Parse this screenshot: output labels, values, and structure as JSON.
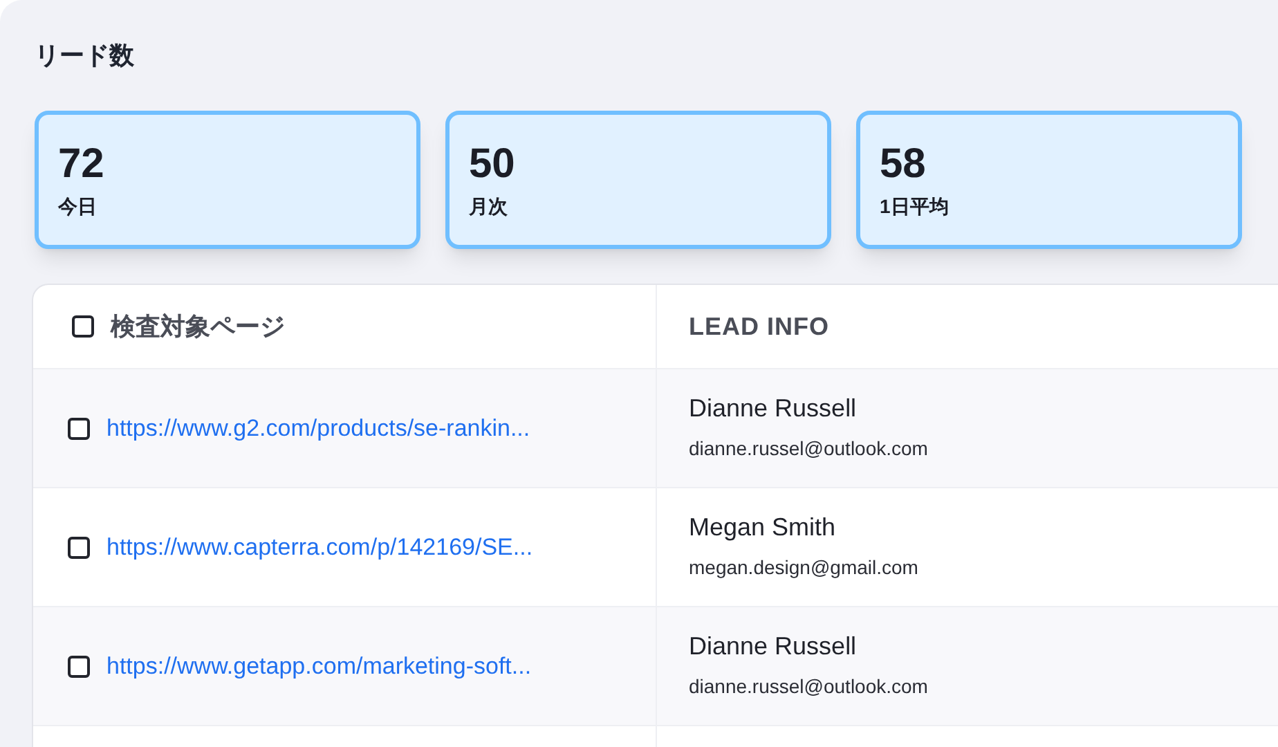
{
  "title": "リード数",
  "stats": [
    {
      "value": "72",
      "label": "今日"
    },
    {
      "value": "50",
      "label": "月次"
    },
    {
      "value": "58",
      "label": "1日平均"
    }
  ],
  "table": {
    "columns": [
      {
        "label": "検査対象ページ",
        "checked": false
      },
      {
        "label": "LEAD INFO"
      }
    ],
    "rows": [
      {
        "checked": false,
        "url": "https://www.g2.com/products/se-rankin...",
        "name": "Dianne Russell",
        "email": "dianne.russel@outlook.com"
      },
      {
        "checked": false,
        "url": "https://www.capterra.com/p/142169/SE...",
        "name": "Megan Smith",
        "email": "megan.design@gmail.com"
      },
      {
        "checked": false,
        "url": "https://www.getapp.com/marketing-soft...",
        "name": "Dianne Russell",
        "email": "dianne.russel@outlook.com"
      }
    ]
  }
}
